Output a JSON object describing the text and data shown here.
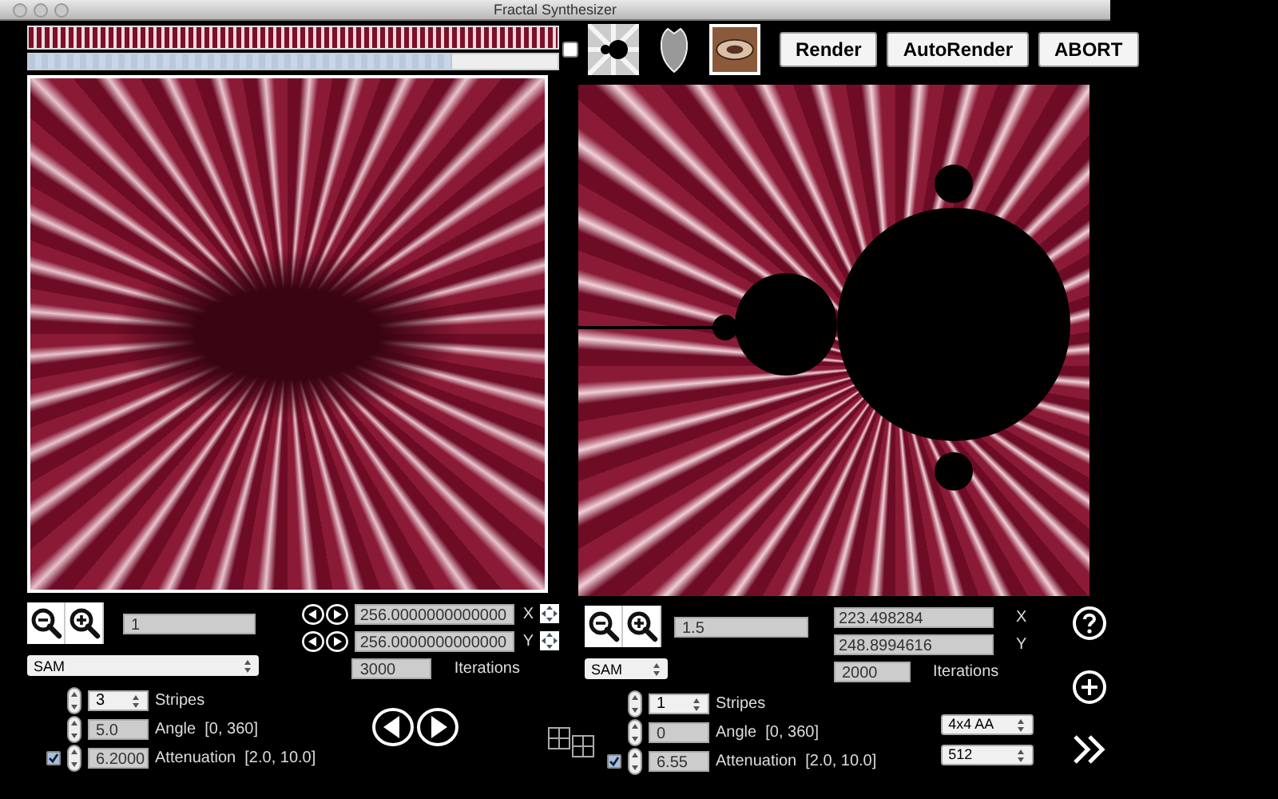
{
  "window": {
    "title": "Fractal Synthesizer"
  },
  "toolbar": {
    "checkbox": {
      "checked": false
    },
    "thumbnails": [
      {
        "kind": "mandelbrot",
        "selected": false
      },
      {
        "kind": "leaf",
        "selected": false
      },
      {
        "kind": "swirl",
        "selected": true
      }
    ],
    "buttons": [
      "Render",
      "AutoRender",
      "ABORT"
    ]
  },
  "left": {
    "progress": {
      "level": 0.8
    },
    "zoom": "1",
    "mode": "SAM",
    "x": {
      "value": "256.0000000000000",
      "label": "X"
    },
    "y": {
      "value": "256.0000000000000",
      "label": "Y"
    },
    "iterations": {
      "value": "3000",
      "label": "Iterations"
    },
    "stripes": {
      "value": "3",
      "label": "Stripes"
    },
    "angle": {
      "value": "5.0",
      "label": "Angle  [0, 360]"
    },
    "attenuation": {
      "value": "6.2000",
      "label": "Attenuation  [2.0, 10.0]",
      "checked": true
    }
  },
  "right": {
    "zoom": "1.5",
    "mode": "SAM",
    "x": {
      "value": "223.498284",
      "label": "X"
    },
    "y": {
      "value": "248.8994616",
      "label": "Y"
    },
    "iterations": {
      "value": "2000",
      "label": "Iterations"
    },
    "stripes": {
      "value": "1",
      "label": "Stripes"
    },
    "angle": {
      "value": "0",
      "label": "Angle  [0, 360]"
    },
    "attenuation": {
      "value": "6.55",
      "label": "Attenuation  [2.0, 10.0]",
      "checked": true
    },
    "antialias": "4x4 AA",
    "size": "512"
  }
}
